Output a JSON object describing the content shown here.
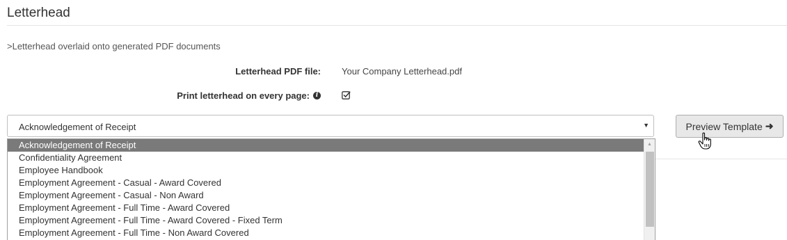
{
  "section": {
    "title": "Letterhead",
    "description": ">Letterhead overlaid onto generated PDF documents"
  },
  "fields": {
    "pdf_file_label": "Letterhead PDF file:",
    "pdf_file_value": "Your Company Letterhead.pdf",
    "every_page_label": "Print letterhead on every page:",
    "every_page_checked": true,
    "info_icon": "info-circle-icon",
    "checkbox_icon": "check-square-icon"
  },
  "template_select": {
    "selected": "Acknowledgement of Receipt",
    "caret_icon": "caret-down-icon",
    "options": [
      "Acknowledgement of Receipt",
      "Confidentiality Agreement",
      "Employee Handbook",
      "Employment Agreement - Casual - Award Covered",
      "Employment Agreement - Casual - Non Award",
      "Employment Agreement - Full Time - Award Covered",
      "Employment Agreement - Full Time - Award Covered - Fixed Term",
      "Employment Agreement - Full Time - Non Award Covered"
    ],
    "highlighted_index": 0
  },
  "preview_button": {
    "label": "Preview Template",
    "icon": "arrow-right-icon"
  },
  "colors": {
    "highlight": "#7a7a7a",
    "button_bg": "#e8e8e8",
    "border": "#bfbfbf"
  }
}
